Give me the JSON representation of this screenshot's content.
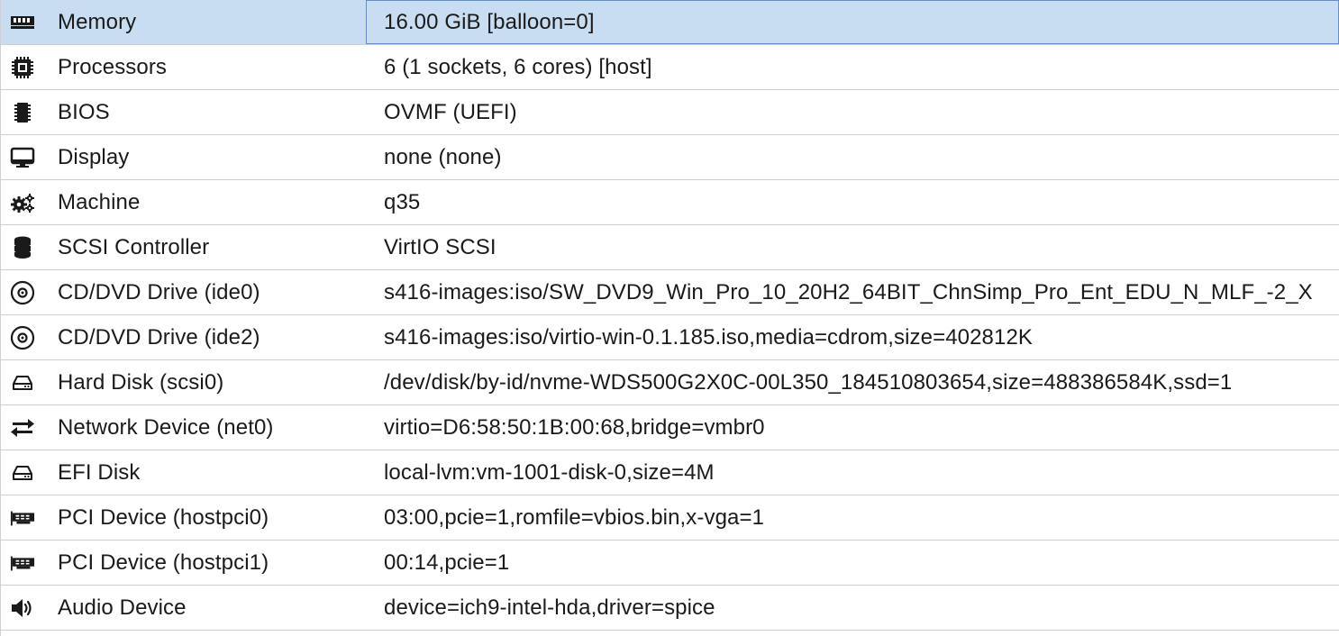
{
  "hardware": {
    "rows": [
      {
        "key": "Memory",
        "value": "16.00 GiB [balloon=0]",
        "icon": "memory-icon",
        "selected": true
      },
      {
        "key": "Processors",
        "value": "6 (1 sockets, 6 cores) [host]",
        "icon": "cpu-icon"
      },
      {
        "key": "BIOS",
        "value": "OVMF (UEFI)",
        "icon": "chip-icon"
      },
      {
        "key": "Display",
        "value": "none (none)",
        "icon": "monitor-icon"
      },
      {
        "key": "Machine",
        "value": "q35",
        "icon": "cogs-icon"
      },
      {
        "key": "SCSI Controller",
        "value": "VirtIO SCSI",
        "icon": "database-icon"
      },
      {
        "key": "CD/DVD Drive (ide0)",
        "value": "s416-images:iso/SW_DVD9_Win_Pro_10_20H2_64BIT_ChnSimp_Pro_Ent_EDU_N_MLF_-2_X",
        "icon": "cdrom-icon"
      },
      {
        "key": "CD/DVD Drive (ide2)",
        "value": "s416-images:iso/virtio-win-0.1.185.iso,media=cdrom,size=402812K",
        "icon": "cdrom-icon"
      },
      {
        "key": "Hard Disk (scsi0)",
        "value": "/dev/disk/by-id/nvme-WDS500G2X0C-00L350_184510803654,size=488386584K,ssd=1",
        "icon": "hard-disk-icon"
      },
      {
        "key": "Network Device (net0)",
        "value": "virtio=D6:58:50:1B:00:68,bridge=vmbr0",
        "icon": "exchange-icon"
      },
      {
        "key": "EFI Disk",
        "value": "local-lvm:vm-1001-disk-0,size=4M",
        "icon": "hard-disk-icon"
      },
      {
        "key": "PCI Device (hostpci0)",
        "value": "03:00,pcie=1,romfile=vbios.bin,x-vga=1",
        "icon": "pci-card-icon"
      },
      {
        "key": "PCI Device (hostpci1)",
        "value": "00:14,pcie=1",
        "icon": "pci-card-icon"
      },
      {
        "key": "Audio Device",
        "value": "device=ich9-intel-hda,driver=spice",
        "icon": "speaker-icon"
      }
    ]
  },
  "colors": {
    "selected_row": "#c8ddf1",
    "selected_border": "#5f8fc4",
    "grid_line": "#cfcfcf"
  }
}
